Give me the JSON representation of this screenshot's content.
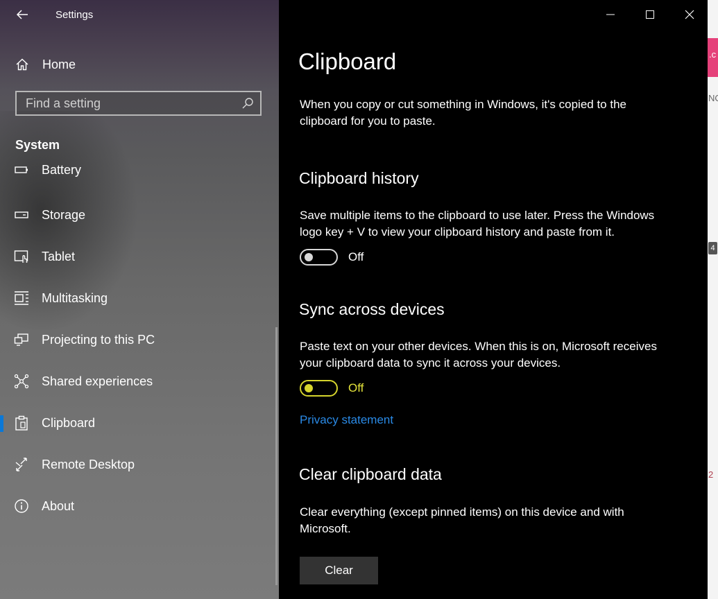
{
  "window": {
    "app_title": "Settings"
  },
  "sidebar": {
    "home_label": "Home",
    "search_placeholder": "Find a setting",
    "section_header": "System",
    "items": [
      {
        "label": "Battery",
        "icon": "battery-icon"
      },
      {
        "label": "Storage",
        "icon": "storage-icon"
      },
      {
        "label": "Tablet",
        "icon": "tablet-icon"
      },
      {
        "label": "Multitasking",
        "icon": "multitasking-icon"
      },
      {
        "label": "Projecting to this PC",
        "icon": "projecting-icon"
      },
      {
        "label": "Shared experiences",
        "icon": "shared-experiences-icon"
      },
      {
        "label": "Clipboard",
        "icon": "clipboard-icon",
        "active": true
      },
      {
        "label": "Remote Desktop",
        "icon": "remote-desktop-icon"
      },
      {
        "label": "About",
        "icon": "info-icon"
      }
    ]
  },
  "main": {
    "title": "Clipboard",
    "intro": "When you copy or cut something in Windows, it's copied to the clipboard for you to paste.",
    "history": {
      "title": "Clipboard history",
      "description": "Save multiple items to the clipboard to use later. Press the Windows logo key + V to view your clipboard history and paste from it.",
      "toggle_state": "Off"
    },
    "sync": {
      "title": "Sync across devices",
      "description": "Paste text on your other devices. When this is on, Microsoft receives your clipboard data to sync it across your devices.",
      "toggle_state": "Off"
    },
    "privacy_link": "Privacy statement",
    "clear_section": {
      "title": "Clear clipboard data",
      "description": "Clear everything (except pinned items) on this device and with Microsoft.",
      "button_label": "Clear"
    }
  },
  "background_window": {
    "snippets": [
      ".c",
      "NO",
      "4",
      "2"
    ]
  },
  "colors": {
    "accent": "#0a78d7",
    "link": "#2a8ae6",
    "focus_toggle": "#d6d52d",
    "main_bg": "#000000",
    "button_bg": "#333333"
  }
}
